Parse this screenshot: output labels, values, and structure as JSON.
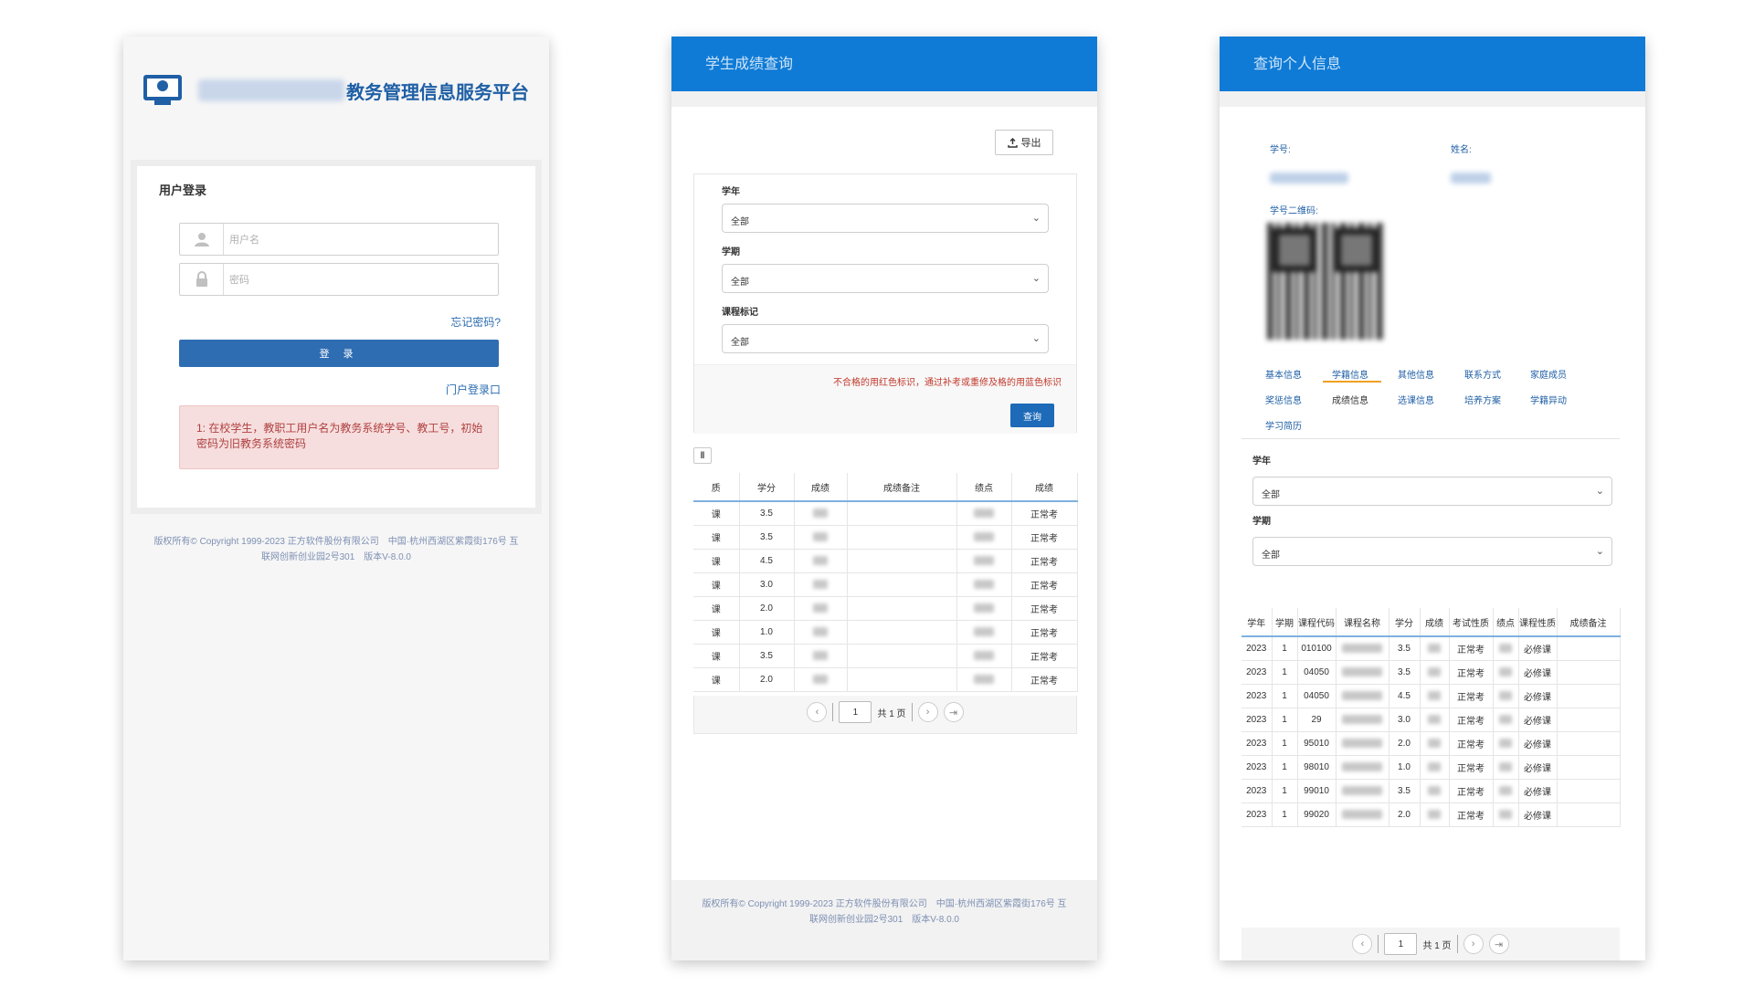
{
  "login": {
    "platform_title": "教务管理信息服务平台",
    "heading": "用户登录",
    "username_placeholder": "用户名",
    "password_placeholder": "密码",
    "forgot_password": "忘记密码?",
    "login_button": "登 录",
    "portal_login": "门户登录口",
    "notice": "1: 在校学生，教职工用户名为教务系统学号、教工号，初始密码为旧教务系统密码",
    "footer_line1": "版权所有© Copyright 1999-2023 正方软件股份有限公司　中国·杭州西湖区紫霞街176号 互",
    "footer_line2": "联网创新创业园2号301　版本V-8.0.0"
  },
  "grades": {
    "header_title": "学生成绩查询",
    "export_label": "导出",
    "year_label": "学年",
    "year_value": "全部",
    "term_label": "学期",
    "term_value": "全部",
    "course_mark_label": "课程标记",
    "course_mark_value": "全部",
    "red_tip": "不合格的用红色标识，通过补考或重修及格的用蓝色标识",
    "query_button": "查询",
    "sort_icon": "‖",
    "columns": [
      "质",
      "学分",
      "成绩",
      "成绩备注",
      "绩点",
      "成绩"
    ],
    "rows": [
      {
        "a": "课",
        "credit": "3.5",
        "exam": "正常考"
      },
      {
        "a": "课",
        "credit": "3.5",
        "exam": "正常考"
      },
      {
        "a": "课",
        "credit": "4.5",
        "exam": "正常考"
      },
      {
        "a": "课",
        "credit": "3.0",
        "exam": "正常考"
      },
      {
        "a": "课",
        "credit": "2.0",
        "exam": "正常考"
      },
      {
        "a": "课",
        "credit": "1.0",
        "exam": "正常考"
      },
      {
        "a": "课",
        "credit": "3.5",
        "exam": "正常考"
      },
      {
        "a": "课",
        "credit": "2.0",
        "exam": "正常考"
      }
    ],
    "pager": {
      "page": "1",
      "total": "共 1 页"
    },
    "footer_line1": "版权所有© Copyright 1999-2023 正方软件股份有限公司　中国·杭州西湖区紫霞街176号 互",
    "footer_line2": "联网创新创业园2号301　版本V-8.0.0"
  },
  "personal": {
    "header_title": "查询个人信息",
    "student_id_label": "学号:",
    "name_label": "姓名:",
    "qr_label": "学号二维码:",
    "tabs": [
      "基本信息",
      "学籍信息",
      "其他信息",
      "联系方式",
      "家庭成员",
      "奖惩信息",
      "成绩信息",
      "选课信息",
      "培养方案",
      "学籍异动",
      "学习简历"
    ],
    "year_label": "学年",
    "year_value": "全部",
    "term_label": "学期",
    "term_value": "全部",
    "columns": [
      "学年",
      "学期",
      "课程代码",
      "课程名称",
      "学分",
      "成绩",
      "考试性质",
      "绩点",
      "课程性质",
      "成绩备注"
    ],
    "rows": [
      {
        "year": "2023",
        "term": "1",
        "code": "010100",
        "credit": "3.5",
        "exam": "正常考",
        "nature": "必修课"
      },
      {
        "year": "2023",
        "term": "1",
        "code": "04050",
        "credit": "3.5",
        "exam": "正常考",
        "nature": "必修课"
      },
      {
        "year": "2023",
        "term": "1",
        "code": "04050",
        "credit": "4.5",
        "exam": "正常考",
        "nature": "必修课"
      },
      {
        "year": "2023",
        "term": "1",
        "code": "29",
        "credit": "3.0",
        "exam": "正常考",
        "nature": "必修课"
      },
      {
        "year": "2023",
        "term": "1",
        "code": "95010",
        "credit": "2.0",
        "exam": "正常考",
        "nature": "必修课"
      },
      {
        "year": "2023",
        "term": "1",
        "code": "98010",
        "credit": "1.0",
        "exam": "正常考",
        "nature": "必修课"
      },
      {
        "year": "2023",
        "term": "1",
        "code": "99010",
        "credit": "3.5",
        "exam": "正常考",
        "nature": "必修课"
      },
      {
        "year": "2023",
        "term": "1",
        "code": "99020",
        "credit": "2.0",
        "exam": "正常考",
        "nature": "必修课"
      }
    ],
    "pager": {
      "page": "1",
      "total": "共 1 页"
    }
  },
  "colors": {
    "header_blue": "#0f7bd6",
    "button_blue": "#2f6db3",
    "notice_bg": "#f6dede",
    "tab_active": "#f0a020",
    "tip_red": "#c0392b"
  }
}
